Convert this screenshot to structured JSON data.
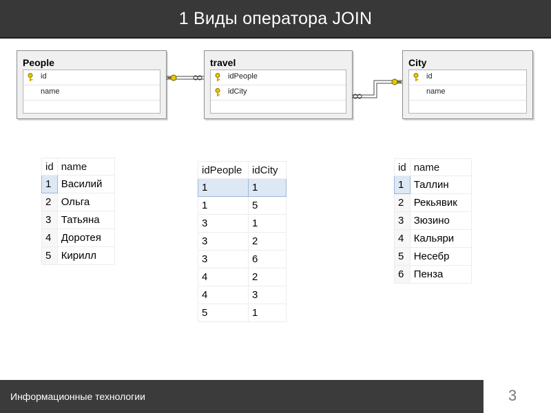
{
  "header": {
    "title": "1 Виды оператора JOIN"
  },
  "diagram": {
    "entities": [
      {
        "name": "People",
        "fields": [
          {
            "name": "id",
            "key": true
          },
          {
            "name": "name",
            "key": false
          }
        ]
      },
      {
        "name": "travel",
        "fields": [
          {
            "name": "idPeople",
            "key": true
          },
          {
            "name": "idCity",
            "key": true
          }
        ]
      },
      {
        "name": "City",
        "fields": [
          {
            "name": "id",
            "key": true
          },
          {
            "name": "name",
            "key": false
          }
        ]
      }
    ]
  },
  "tables": {
    "people": {
      "columns": [
        "id",
        "name"
      ],
      "rows": [
        [
          "1",
          "Василий"
        ],
        [
          "2",
          "Ольга"
        ],
        [
          "3",
          "Татьяна"
        ],
        [
          "4",
          "Доротея"
        ],
        [
          "5",
          "Кирилл"
        ]
      ]
    },
    "travel": {
      "columns": [
        "idPeople",
        "idCity"
      ],
      "rows": [
        [
          "1",
          "1"
        ],
        [
          "1",
          "5"
        ],
        [
          "3",
          "1"
        ],
        [
          "3",
          "2"
        ],
        [
          "3",
          "6"
        ],
        [
          "4",
          "2"
        ],
        [
          "4",
          "3"
        ],
        [
          "5",
          "1"
        ]
      ]
    },
    "city": {
      "columns": [
        "id",
        "name"
      ],
      "rows": [
        [
          "1",
          "Таллин"
        ],
        [
          "2",
          "Рекьявик"
        ],
        [
          "3",
          "Зюзино"
        ],
        [
          "4",
          "Кальяри"
        ],
        [
          "5",
          "Несебр"
        ],
        [
          "6",
          "Пенза"
        ]
      ]
    }
  },
  "footer": {
    "text": "Информационные технологии",
    "page": "3"
  },
  "colors": {
    "header_bg": "#383838",
    "footer_bg": "#3b3b3b",
    "key_icon": "#d6b400",
    "selection": "#dde8f4"
  }
}
